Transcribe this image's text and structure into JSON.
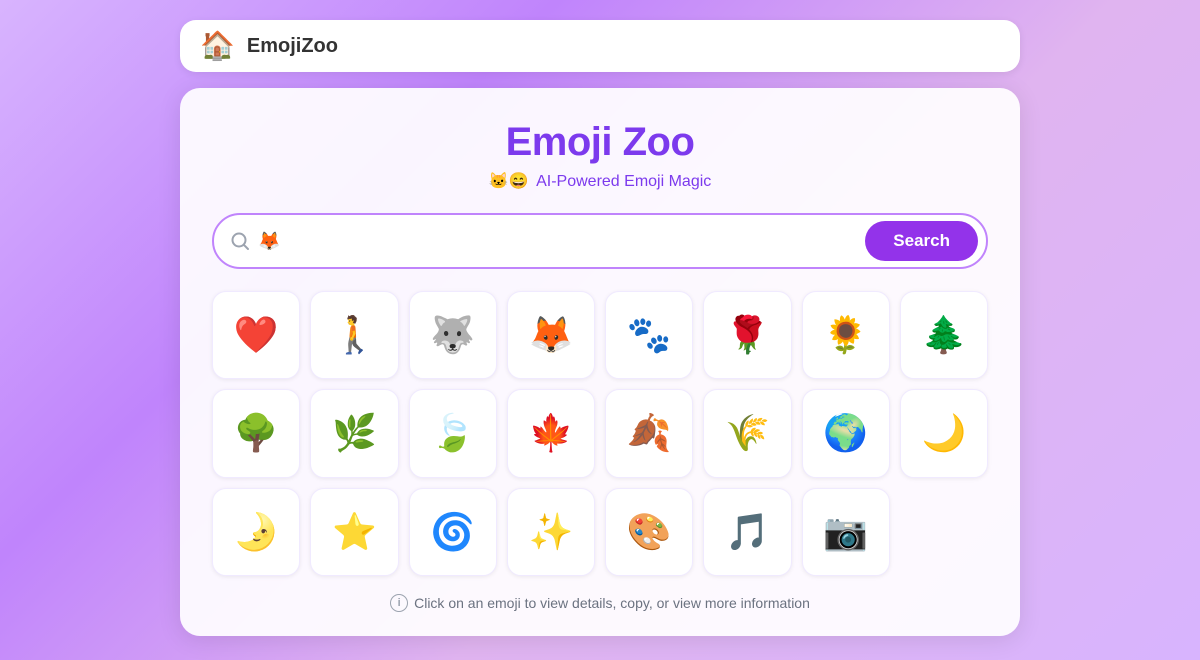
{
  "nav": {
    "logo_icon": "🏠",
    "title": "EmojiZoo"
  },
  "main": {
    "title": "Emoji Zoo",
    "subtitle_emojis": "🐱😄",
    "subtitle_text": "AI-Powered Emoji Magic",
    "search": {
      "placeholder": "🦊",
      "input_value": "🦊",
      "button_label": "Search"
    },
    "info_text": "Click on an emoji to view details, copy, or view more information",
    "emoji_rows": [
      [
        "❤️",
        "🚶",
        "🐺",
        "🦊",
        "🐾",
        "🌹",
        "🌻",
        "🌲"
      ],
      [
        "🌳",
        "🌿",
        "🍃",
        "🍁",
        "🍂",
        "🌾",
        "🌍",
        "🌙"
      ],
      [
        "🌛",
        "⭐",
        "🌀",
        "✨",
        "🎨",
        "🎵",
        "📷",
        ""
      ]
    ]
  },
  "colors": {
    "accent": "#9333ea",
    "accent_light": "#c084fc",
    "title_color": "#7c3aed"
  }
}
